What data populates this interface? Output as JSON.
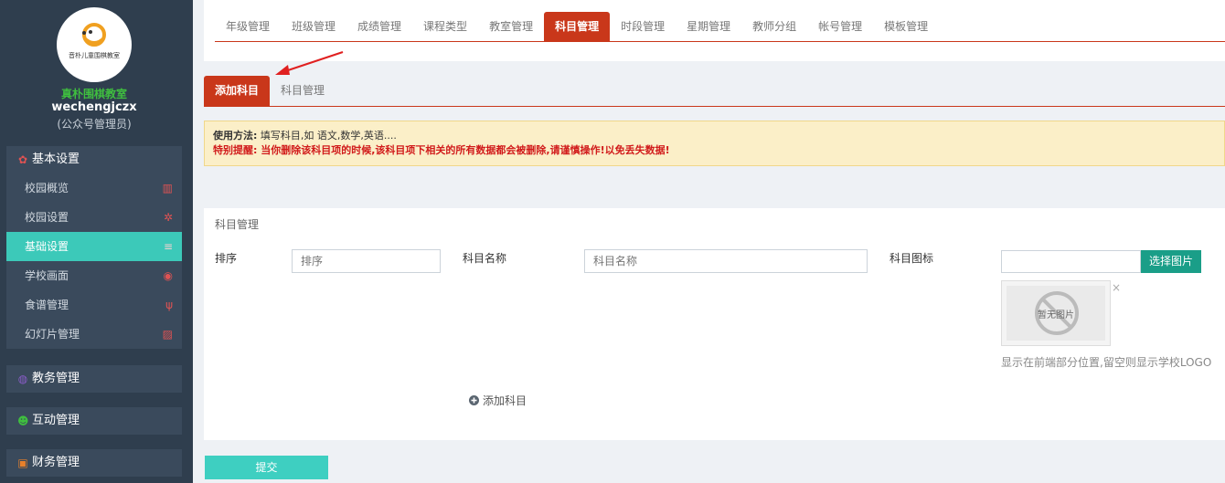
{
  "sidebar": {
    "logo_caption": "音朴儿童围棋教室",
    "school_name": "真朴围棋教室",
    "user": "wechengjczx",
    "role": "(公众号管理员)",
    "groups": [
      {
        "label": "基本设置",
        "icon": "gear-icon",
        "items": [
          {
            "label": "校园概览",
            "icon": "bank-icon"
          },
          {
            "label": "校园设置",
            "icon": "gear-icon"
          },
          {
            "label": "基础设置",
            "icon": "list-icon",
            "active": true
          },
          {
            "label": "学校画面",
            "icon": "eye-icon"
          },
          {
            "label": "食谱管理",
            "icon": "cutlery-icon"
          },
          {
            "label": "幻灯片管理",
            "icon": "image-icon"
          }
        ]
      },
      {
        "label": "教务管理",
        "icon": "database-icon"
      },
      {
        "label": "互动管理",
        "icon": "wechat-icon"
      },
      {
        "label": "财务管理",
        "icon": "money-icon"
      }
    ]
  },
  "top_tabs": [
    "年级管理",
    "班级管理",
    "成绩管理",
    "课程类型",
    "教室管理",
    "科目管理",
    "时段管理",
    "星期管理",
    "教师分组",
    "帐号管理",
    "模板管理"
  ],
  "top_tab_active": "科目管理",
  "sub_tabs": [
    "添加科目",
    "科目管理"
  ],
  "sub_tab_active": "添加科目",
  "notice": {
    "label": "使用方法:",
    "text": "填写科目,如 语文,数学,英语....",
    "warning": "特别提醒: 当你删除该科目项的时候,该科目项下相关的所有数据都会被删除,请谨慎操作!以免丢失数据!"
  },
  "form": {
    "title": "科目管理",
    "order_label": "排序",
    "order_placeholder": "排序",
    "name_label": "科目名称",
    "name_placeholder": "科目名称",
    "icon_label": "科目图标",
    "pick_button": "选择图片",
    "no_image": "暂无图片",
    "close": "×",
    "hint": "显示在前端部分位置,留空则显示学校LOGO",
    "add_subject": "添加科目"
  },
  "submit_label": "提交",
  "colors": {
    "accent": "#c9371a",
    "teal": "#3cc9b9",
    "sidebar_bg": "#2f3e4e"
  }
}
